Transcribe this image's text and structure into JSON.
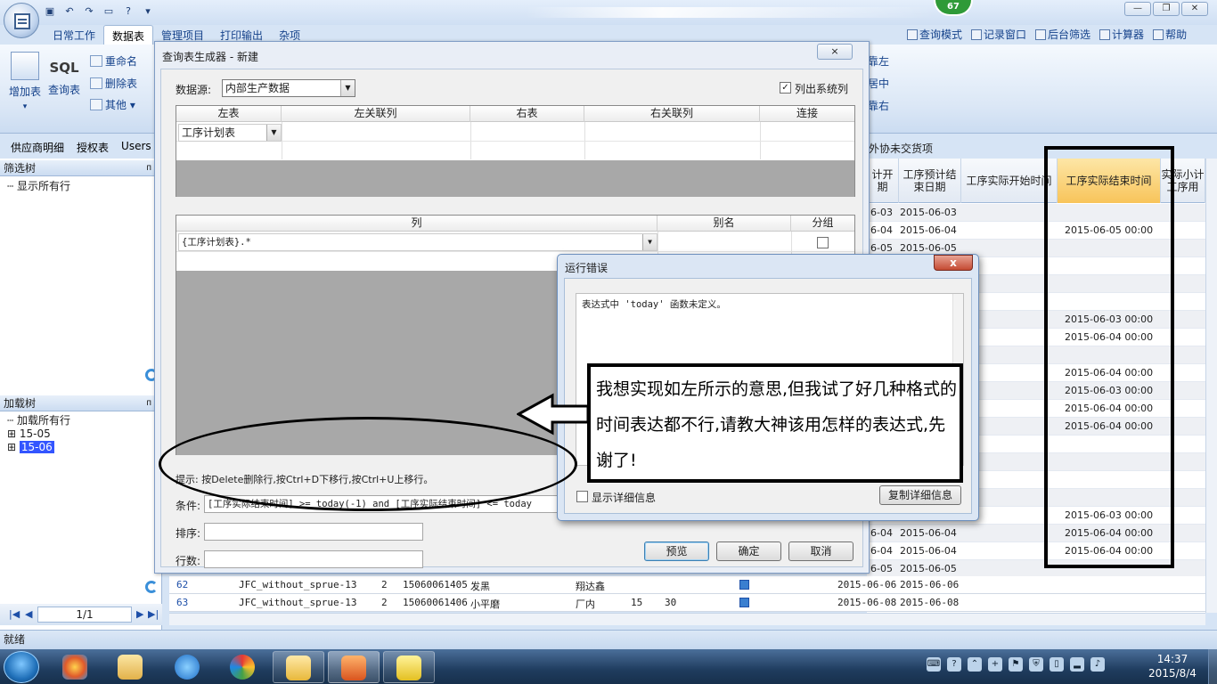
{
  "ribbon": {
    "tabs": [
      "日常工作",
      "数据表",
      "管理项目",
      "打印输出",
      "杂项"
    ],
    "active_tab": "数据表",
    "right_items": [
      "查询模式",
      "记录窗口",
      "后台筛选",
      "计算器",
      "帮助"
    ],
    "big_buttons": [
      "增加表",
      "SQL",
      "查询表"
    ],
    "small_buttons": [
      "重命名",
      "删除表",
      "其他"
    ],
    "align_buttons": [
      "靠左",
      "居中",
      "靠右"
    ],
    "badge": "67"
  },
  "doc_tabs": [
    "供应商明细",
    "授权表",
    "Users"
  ],
  "doc_tab_right": "外协未交货项",
  "left_panel": {
    "filter_tree_title": "筛选树",
    "filter_tree_items": [
      "显示所有行"
    ],
    "load_tree_title": "加载树",
    "load_tree_items": [
      "加载所有行",
      "15-05",
      "15-06"
    ],
    "pager": "1/1"
  },
  "bg_grid": {
    "headers": [
      "计开期",
      "工序预计结束日期",
      "工序实际开始时间",
      "工序实际结束时间",
      "实际小计工序用"
    ],
    "rows": [
      {
        "start": "6-03",
        "end": "2015-06-03",
        "actual_end": ""
      },
      {
        "start": "6-04",
        "end": "2015-06-04",
        "actual_end": "2015-06-05 00:00"
      },
      {
        "start": "6-05",
        "end": "2015-06-05",
        "actual_end": ""
      },
      {
        "start": "",
        "end": "",
        "actual_end": ""
      },
      {
        "start": "",
        "end": "",
        "actual_end": ""
      },
      {
        "start": "",
        "end": "",
        "actual_end": ""
      },
      {
        "start": "",
        "end": "",
        "actual_end": "2015-06-03 00:00"
      },
      {
        "start": "",
        "end": "",
        "actual_end": "2015-06-04 00:00"
      },
      {
        "start": "",
        "end": "",
        "actual_end": ""
      },
      {
        "start": "",
        "end": "",
        "actual_end": "2015-06-04 00:00"
      },
      {
        "start": "",
        "end": "",
        "actual_end": "2015-06-03 00:00"
      },
      {
        "start": "",
        "end": "",
        "actual_end": "2015-06-04 00:00"
      },
      {
        "start": "",
        "end": "",
        "actual_end": "2015-06-04 00:00"
      },
      {
        "start": "",
        "end": "",
        "actual_end": ""
      },
      {
        "start": "",
        "end": "",
        "actual_end": ""
      },
      {
        "start": "",
        "end": "",
        "actual_end": ""
      },
      {
        "start": "",
        "end": "",
        "actual_end": ""
      },
      {
        "start": "",
        "end": "",
        "actual_end": "2015-06-03 00:00"
      },
      {
        "start": "6-04",
        "end": "2015-06-04",
        "actual_end": "2015-06-04 00:00"
      },
      {
        "start": "6-04",
        "end": "2015-06-04",
        "actual_end": "2015-06-04 00:00"
      },
      {
        "start": "6-05",
        "end": "2015-06-05",
        "actual_end": ""
      }
    ],
    "bottom_rows": [
      {
        "no": "62",
        "name": "JFC_without_sprue-13",
        "qty": "2",
        "code": "15060061405",
        "proc": "发黑",
        "vendor": "翔达鑫",
        "a": "",
        "b": "",
        "start": "2015-06-06",
        "end": "2015-06-06"
      },
      {
        "no": "63",
        "name": "JFC_without_sprue-13",
        "qty": "2",
        "code": "15060061406",
        "proc": "小平磨",
        "vendor": "厂内",
        "a": "15",
        "b": "30",
        "start": "2015-06-08",
        "end": "2015-06-08"
      }
    ]
  },
  "status": "就绪",
  "query_dialog": {
    "title": "查询表生成器 - 新建",
    "close": "×",
    "datasource_label": "数据源:",
    "datasource_value": "内部生产数据",
    "list_system_columns": "列出系统列",
    "join_headers": [
      "左表",
      "左关联列",
      "右表",
      "右关联列",
      "连接"
    ],
    "join_row": "工序计划表",
    "column_headers": [
      "列",
      "别名",
      "分组"
    ],
    "column_row": "{工序计划表}.*",
    "hint": "提示: 按Delete删除行,按Ctrl+D下移行,按Ctrl+U上移行。",
    "condition_label": "条件:",
    "condition_value": "[工序实际结束时间] >= today(-1) and [工序实际结束时间] <= today",
    "sort_label": "排序:",
    "rows_label": "行数:",
    "preview": "预览",
    "ok": "确定",
    "cancel": "取消"
  },
  "error_dialog": {
    "title": "运行错误",
    "close": "x",
    "message": "表达式中 'today' 函数未定义。",
    "show_details": "显示详细信息",
    "copy_details": "复制详细信息"
  },
  "annotation": "我想实现如左所示的意思,但我试了好几种格式的时间表达都不行,请教大神该用怎样的表达式,先谢了!",
  "taskbar": {
    "time": "14:37",
    "date": "2015/8/4"
  }
}
